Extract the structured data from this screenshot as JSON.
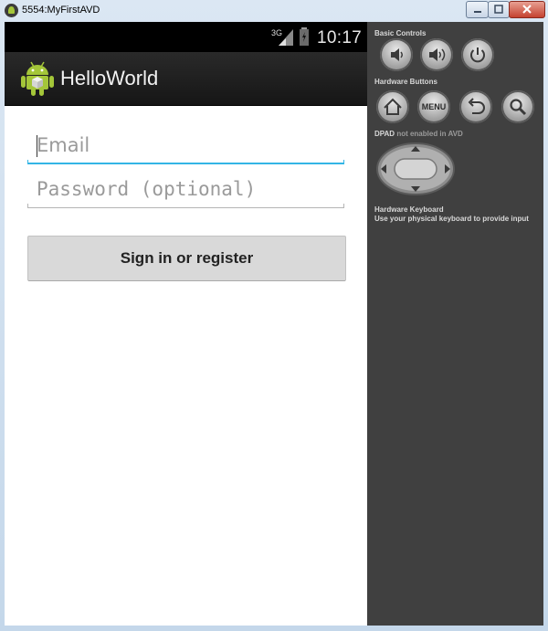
{
  "window": {
    "title": "5554:MyFirstAVD"
  },
  "statusbar": {
    "network": "3G",
    "time": "10:17"
  },
  "actionbar": {
    "app_title": "HelloWorld"
  },
  "form": {
    "email_placeholder": "Email",
    "email_value": "",
    "password_placeholder": "Password (optional)",
    "password_value": "",
    "signin_label": "Sign in or register"
  },
  "panel": {
    "basic_controls_label": "Basic Controls",
    "hardware_buttons_label": "Hardware Buttons",
    "menu_label": "MENU",
    "dpad_label": "DPAD",
    "dpad_note": "not enabled in AVD",
    "keyboard_title": "Hardware Keyboard",
    "keyboard_note": "Use your physical keyboard to provide input"
  },
  "colors": {
    "accent": "#33b5e5",
    "actionbar": "#1f1f1f",
    "panel_bg": "#404040",
    "button_bg": "#d9d9d9"
  },
  "icons": [
    "android-logo-icon",
    "signal-icon",
    "battery-icon",
    "volume-down-icon",
    "volume-up-icon",
    "power-icon",
    "home-icon",
    "back-icon",
    "search-icon",
    "dpad-icon"
  ]
}
